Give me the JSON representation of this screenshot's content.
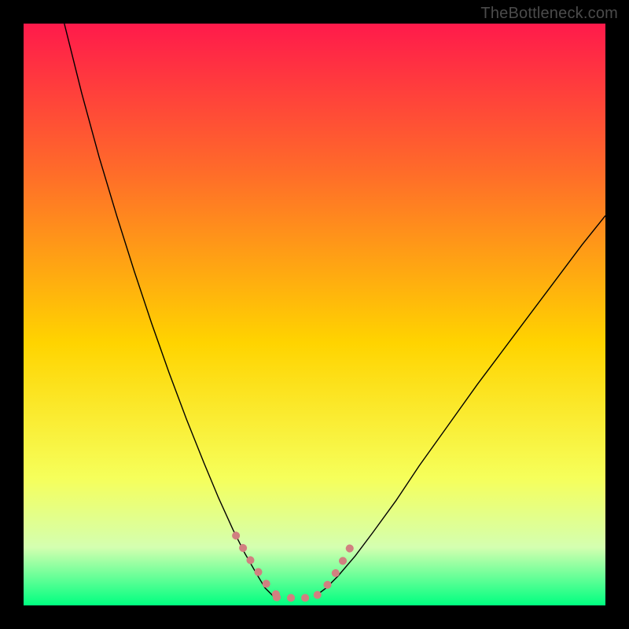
{
  "watermark": "TheBottleneck.com",
  "chart_data": {
    "type": "line",
    "title": "",
    "xlabel": "",
    "ylabel": "",
    "xlim": [
      0,
      100
    ],
    "ylim": [
      0,
      100
    ],
    "grid": false,
    "legend": false,
    "gradient_stops": [
      {
        "offset": 0,
        "color": "#ff1a4b"
      },
      {
        "offset": 0.25,
        "color": "#ff6a2a"
      },
      {
        "offset": 0.55,
        "color": "#ffd400"
      },
      {
        "offset": 0.78,
        "color": "#f6ff5a"
      },
      {
        "offset": 0.9,
        "color": "#d4ffb0"
      },
      {
        "offset": 1.0,
        "color": "#00ff80"
      }
    ],
    "series": [
      {
        "name": "left-curve",
        "stroke": "#000000",
        "stroke_width": 1.4,
        "x": [
          7,
          10,
          13,
          16,
          19,
          22,
          25,
          28,
          31,
          33.5,
          36,
          38,
          40,
          41.5,
          43
        ],
        "y": [
          100,
          88,
          77,
          67,
          57.5,
          48.5,
          40,
          32,
          24.5,
          18.5,
          13,
          9,
          5.5,
          3,
          1.5
        ]
      },
      {
        "name": "right-curve",
        "stroke": "#000000",
        "stroke_width": 1.4,
        "x": [
          50,
          52,
          54,
          57,
          60,
          64,
          68,
          73,
          78,
          84,
          90,
          96,
          100
        ],
        "y": [
          1.5,
          3,
          5,
          8.5,
          12.5,
          18,
          24,
          31,
          38,
          46,
          54,
          62,
          67
        ]
      },
      {
        "name": "dots-left",
        "stroke": "#d18080",
        "stroke_width": 10,
        "linecap": "round",
        "dasharray": "0.1 18",
        "x": [
          36.5,
          38.5,
          40.5,
          42,
          43.5
        ],
        "y": [
          12,
          8.5,
          5.5,
          3.3,
          1.8
        ]
      },
      {
        "name": "dots-bottom",
        "stroke": "#d18080",
        "stroke_width": 10,
        "linecap": "round",
        "dasharray": "0.1 18",
        "x": [
          43.5,
          45.2,
          47,
          48.8,
          50.5
        ],
        "y": [
          1.4,
          1.3,
          1.3,
          1.3,
          1.5
        ]
      },
      {
        "name": "dots-right",
        "stroke": "#d18080",
        "stroke_width": 10,
        "linecap": "round",
        "dasharray": "0.1 18",
        "x": [
          50.5,
          52.2,
          53.8,
          55.3,
          56.8
        ],
        "y": [
          1.8,
          3.5,
          5.8,
          8.4,
          11.2
        ]
      }
    ]
  }
}
